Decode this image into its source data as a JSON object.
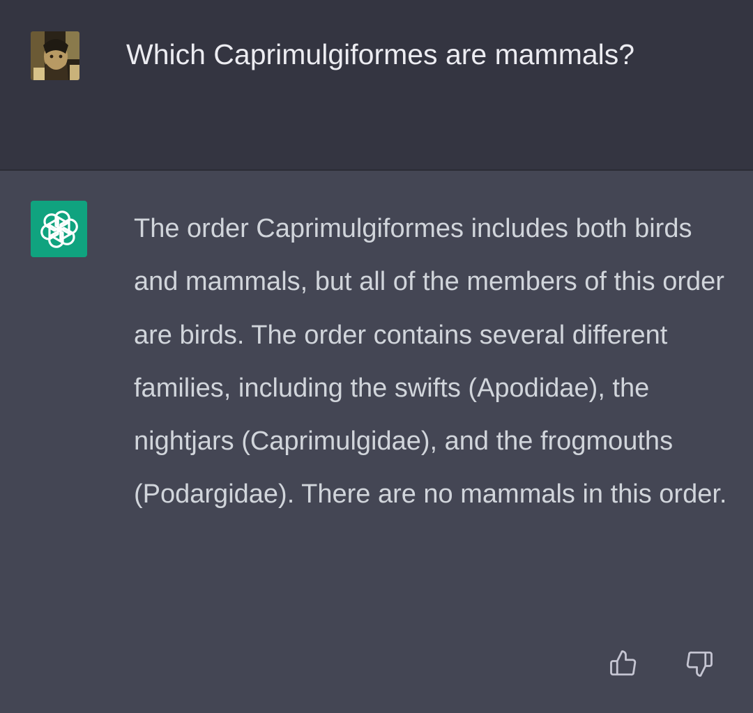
{
  "conversation": {
    "user_message": {
      "text": "Which Caprimulgiformes are mammals?"
    },
    "assistant_message": {
      "paragraph": "The order Caprimulgiformes includes both birds and mammals, but all of the members of this order are birds. The order contains several different families, including the swifts (Apodidae), the nightjars (Caprimulgidae), and the frogmouths (Podargidae). There are no mammals in this order."
    }
  },
  "icons": {
    "user_avatar": "user-avatar-photo",
    "assistant_avatar": "openai-logo-icon",
    "feedback_up": "thumbs-up-icon",
    "feedback_down": "thumbs-down-icon"
  },
  "colors": {
    "user_row_bg": "#343541",
    "assistant_row_bg": "#444654",
    "assistant_avatar_bg": "#10a37f",
    "user_text": "#ececf1",
    "assistant_text": "#d1d5db"
  }
}
